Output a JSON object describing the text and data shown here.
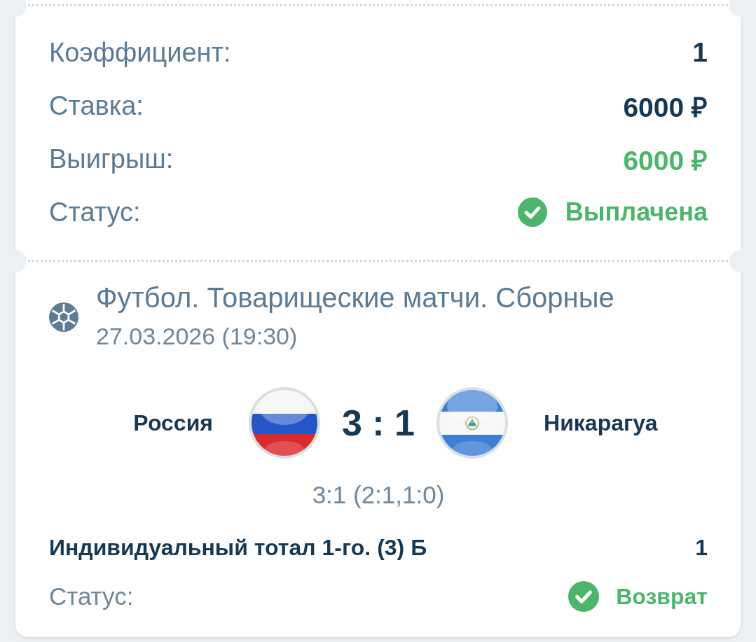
{
  "summary": {
    "rows": [
      {
        "label": "Коэффициент:",
        "value": "1",
        "kind": "plain"
      },
      {
        "label": "Ставка:",
        "value": "6000 ₽",
        "kind": "plain"
      },
      {
        "label": "Выигрыш:",
        "value": "6000 ₽",
        "kind": "win"
      },
      {
        "label": "Статус:",
        "value": "Выплачена",
        "kind": "status"
      }
    ]
  },
  "event": {
    "sport": "Футбол. Товарищеские матчи. Сборные",
    "date": "27.03.2026 (19:30)",
    "home_team": "Россия",
    "score": "3 : 1",
    "away_team": "Никарагуа",
    "score_detail": "3:1 (2:1,1:0)",
    "bet": {
      "market": "Индивидуальный тотал 1-го. (3) Б",
      "odds": "1"
    },
    "status": {
      "label": "Статус:",
      "value": "Возврат"
    }
  }
}
